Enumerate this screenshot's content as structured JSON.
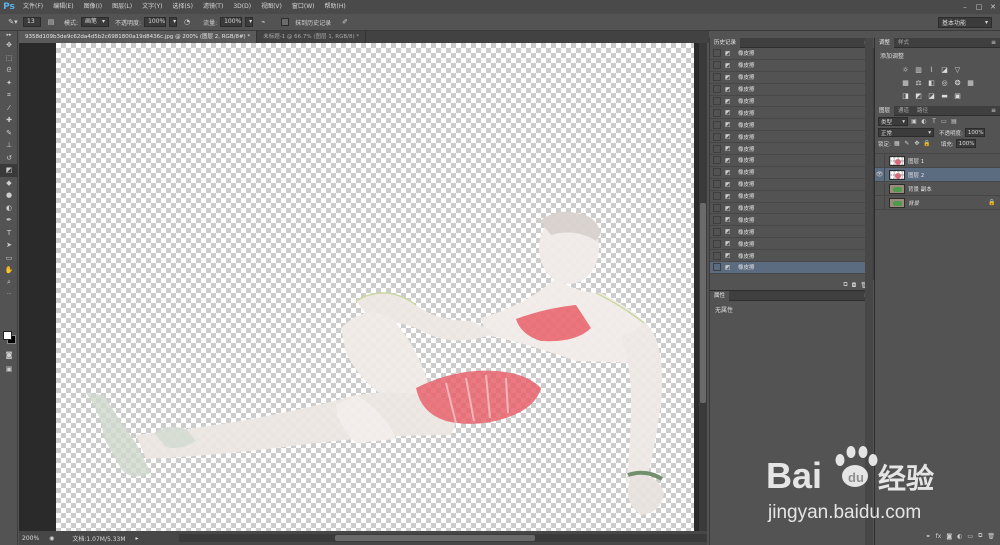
{
  "menubar": {
    "logo": "Ps",
    "items": [
      "文件(F)",
      "编辑(E)",
      "图像(I)",
      "图层(L)",
      "文字(Y)",
      "选择(S)",
      "滤镜(T)",
      "3D(D)",
      "视图(V)",
      "窗口(W)",
      "帮助(H)"
    ]
  },
  "options": {
    "brush_size": "13",
    "mode_label": "模式:",
    "mode_value": "画笔",
    "opacity_label": "不透明度:",
    "opacity_value": "100%",
    "flow_label": "流量:",
    "flow_value": "100%",
    "erase_history_label": "抹到历史记录",
    "workspace": "基本功能"
  },
  "document_tabs": [
    {
      "label": "9358d109b3de9c62da4d5b2c6981800a19d8436c.jpg @ 200% (图层 2, RGB/8#) *",
      "active": true
    },
    {
      "label": "未标题-1 @ 66.7% (图层 1, RGB/8) *",
      "active": false
    }
  ],
  "status": {
    "zoom": "200%",
    "doc_info": "文档:1.07M/5.33M"
  },
  "history": {
    "tabs": [
      "历史记录"
    ],
    "items": [
      "橡皮擦",
      "橡皮擦",
      "橡皮擦",
      "橡皮擦",
      "橡皮擦",
      "橡皮擦",
      "橡皮擦",
      "橡皮擦",
      "橡皮擦",
      "橡皮擦",
      "橡皮擦",
      "橡皮擦",
      "橡皮擦",
      "橡皮擦",
      "橡皮擦",
      "橡皮擦",
      "橡皮擦",
      "橡皮擦",
      "橡皮擦"
    ],
    "selected_index": 18
  },
  "properties": {
    "tab": "属性",
    "body": "无属性"
  },
  "adjustments": {
    "tabs": [
      "调整",
      "样式"
    ],
    "title": "添加调整"
  },
  "layers": {
    "tabs": [
      "图层",
      "通道",
      "路径"
    ],
    "filter_type": "类型",
    "blend_mode": "正常",
    "opacity_label": "不透明度:",
    "opacity_value": "100%",
    "lock_label": "锁定:",
    "fill_label": "填充:",
    "fill_value": "100%",
    "items": [
      {
        "name": "图层 1",
        "visible": false,
        "selected": false,
        "thumb": "transparent"
      },
      {
        "name": "图层 2",
        "visible": true,
        "selected": true,
        "thumb": "transparent"
      },
      {
        "name": "背景 副本",
        "visible": false,
        "selected": false,
        "thumb": "photo"
      },
      {
        "name": "背景",
        "visible": false,
        "selected": false,
        "thumb": "photo",
        "italic": true,
        "locked": true
      }
    ]
  },
  "watermark": {
    "brand_left": "Bai",
    "brand_right": "经验",
    "url": "jingyan.baidu.com"
  },
  "colors": {
    "accent_selected": "#5b6b80",
    "ps_blue": "#5bb2e8",
    "panel_bg": "#535353"
  }
}
